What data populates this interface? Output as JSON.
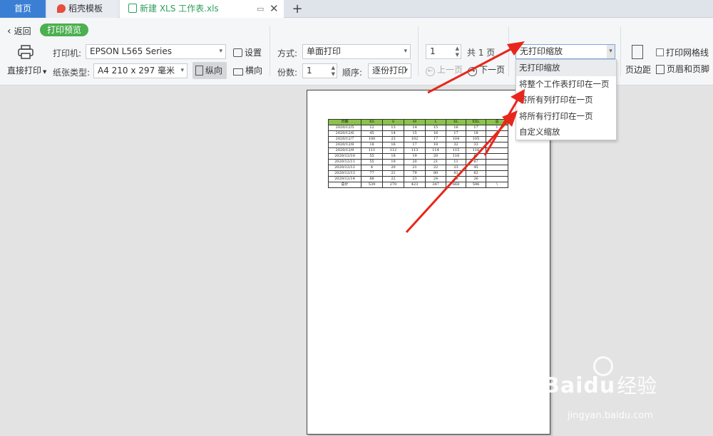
{
  "tabs": {
    "home": "首页",
    "template": "稻壳模板",
    "file": "新建 XLS 工作表.xls",
    "close": "✕",
    "pin": "▭",
    "add": "+"
  },
  "header": {
    "back": "返回",
    "mode": "打印预览"
  },
  "printer": {
    "direct_print": "直接打印",
    "label": "打印机:",
    "value": "EPSON L565 Series",
    "settings": "设置",
    "paper_label": "纸张类型:",
    "paper_value": "A4 210 x 297 毫米",
    "portrait": "纵向",
    "landscape": "横向"
  },
  "mode": {
    "label": "方式:",
    "value": "单面打印",
    "copies_label": "份数:",
    "copies_value": "1",
    "order_label": "顺序:",
    "order_value": "逐份打印"
  },
  "pages": {
    "current": "1",
    "total": "共 1 页",
    "prev": "上一页",
    "next": "下一页"
  },
  "scale": {
    "value": "无打印缩放",
    "options": [
      "无打印缩放",
      "将整个工作表打印在一页",
      "将所有列打印在一页",
      "将所有行打印在一页",
      "自定义缩放"
    ]
  },
  "right": {
    "gridlines": "打印网格线",
    "margins": "页边距",
    "header_footer": "页眉和页脚"
  },
  "sheet": {
    "headers": [
      "日期",
      "XS",
      "S",
      "M",
      "L",
      "XL",
      "XXL",
      "总"
    ],
    "rows": [
      [
        "2020/12/5",
        "12",
        "13",
        "14",
        "15",
        "16",
        "17",
        "1"
      ],
      [
        "2020/12/6",
        "45",
        "14",
        "15",
        "16",
        "17",
        "18",
        ""
      ],
      [
        "2020/12/7",
        "100",
        "23",
        "102",
        "17",
        "104",
        "105",
        ""
      ],
      [
        "2020/12/8",
        "18",
        "16",
        "17",
        "18",
        "32",
        "33",
        ""
      ],
      [
        "2020/12/9",
        "111",
        "112",
        "113",
        "114",
        "115",
        "116",
        ""
      ],
      [
        "2020/12/10",
        "55",
        "18",
        "19",
        "20",
        "116",
        "67",
        ""
      ],
      [
        "2020/12/11",
        "55",
        "19",
        "20",
        "21",
        "11",
        "87",
        ""
      ],
      [
        "2020/12/12",
        "4",
        "20",
        "21",
        "22",
        "23",
        "45",
        ""
      ],
      [
        "2020/12/13",
        "77",
        "21",
        "79",
        "80",
        "81",
        "82",
        ""
      ],
      [
        "2020/12/14",
        "88",
        "22",
        "23",
        "24",
        "25",
        "26",
        ""
      ],
      [
        "总计",
        "539",
        "270",
        "423",
        "347",
        "668",
        "596",
        "\\"
      ]
    ]
  },
  "watermark": {
    "brand": "Baidu",
    "cn": "经验",
    "url": "jingyan.baidu.com"
  },
  "colors": {
    "accent": "#3b7fd4",
    "green": "#4caf50",
    "header_fill": "#8bc34a",
    "arrow": "#e8261c"
  }
}
